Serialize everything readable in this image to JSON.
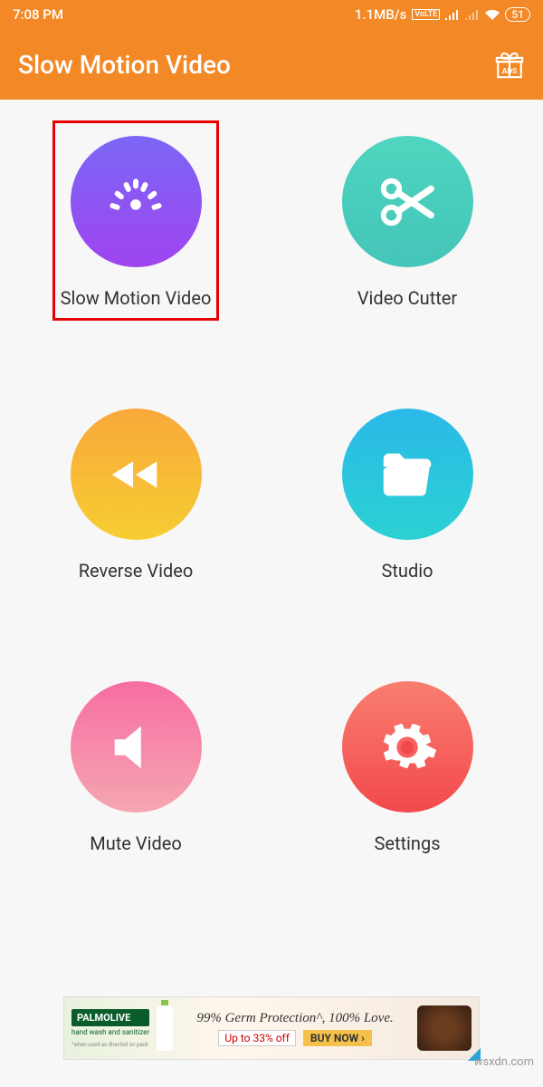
{
  "status": {
    "time": "7:08 PM",
    "net_speed": "1.1MB/s",
    "volte": "VoLTE",
    "battery": "51"
  },
  "header": {
    "title": "Slow Motion Video",
    "ads_label": "ADS"
  },
  "menu": {
    "slow_motion": "Slow Motion Video",
    "video_cutter": "Video Cutter",
    "reverse_video": "Reverse Video",
    "studio": "Studio",
    "mute_video": "Mute Video",
    "settings": "Settings"
  },
  "ad": {
    "brand": "PALMOLIVE",
    "brand_sub": "hand wash and sanitizer",
    "headline": "99% Germ Protection^, 100% Love.",
    "offer": "Up to 33% off",
    "cta": "BUY NOW ›",
    "disclaimer": "^when used as directed on pack"
  },
  "watermark": "wsxdn.com"
}
